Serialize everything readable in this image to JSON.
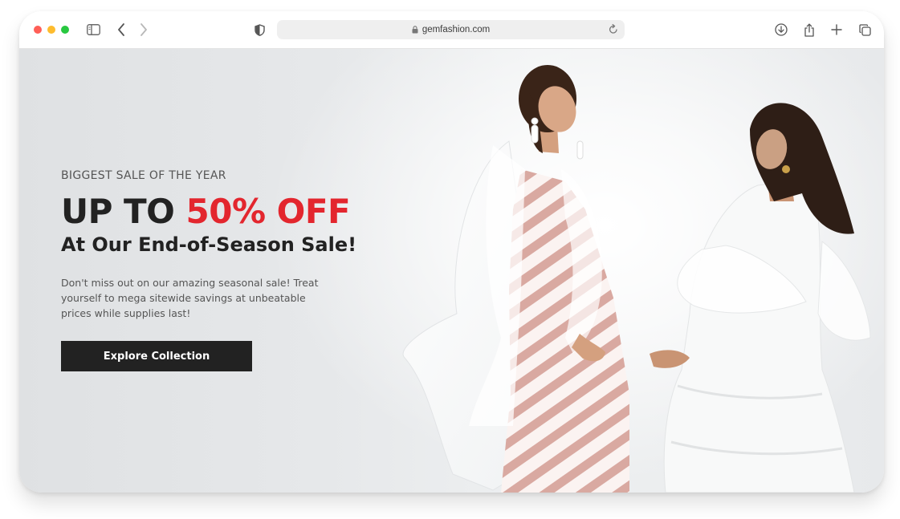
{
  "browser": {
    "url": "gemfashion.com",
    "icons": {
      "sidebar": "sidebar-icon",
      "back": "chevron-left-icon",
      "forward": "chevron-right-icon",
      "privacy": "shield-icon",
      "lock": "lock-icon",
      "reload": "reload-icon",
      "download": "download-icon",
      "share": "share-icon",
      "new_tab": "plus-icon",
      "tabs": "tabs-overview-icon"
    }
  },
  "hero": {
    "eyebrow": "BIGGEST SALE OF THE YEAR",
    "headline_prefix": "UP TO",
    "headline_accent": "50% OFF",
    "subheadline": "At Our End-of-Season Sale!",
    "description": "Don't miss out on our amazing seasonal sale! Treat yourself to mega sitewide savings at unbeatable prices while supplies last!",
    "cta_label": "Explore Collection"
  },
  "colors": {
    "accent": "#e3262e",
    "text_dark": "#222222",
    "button_bg": "#222222"
  }
}
